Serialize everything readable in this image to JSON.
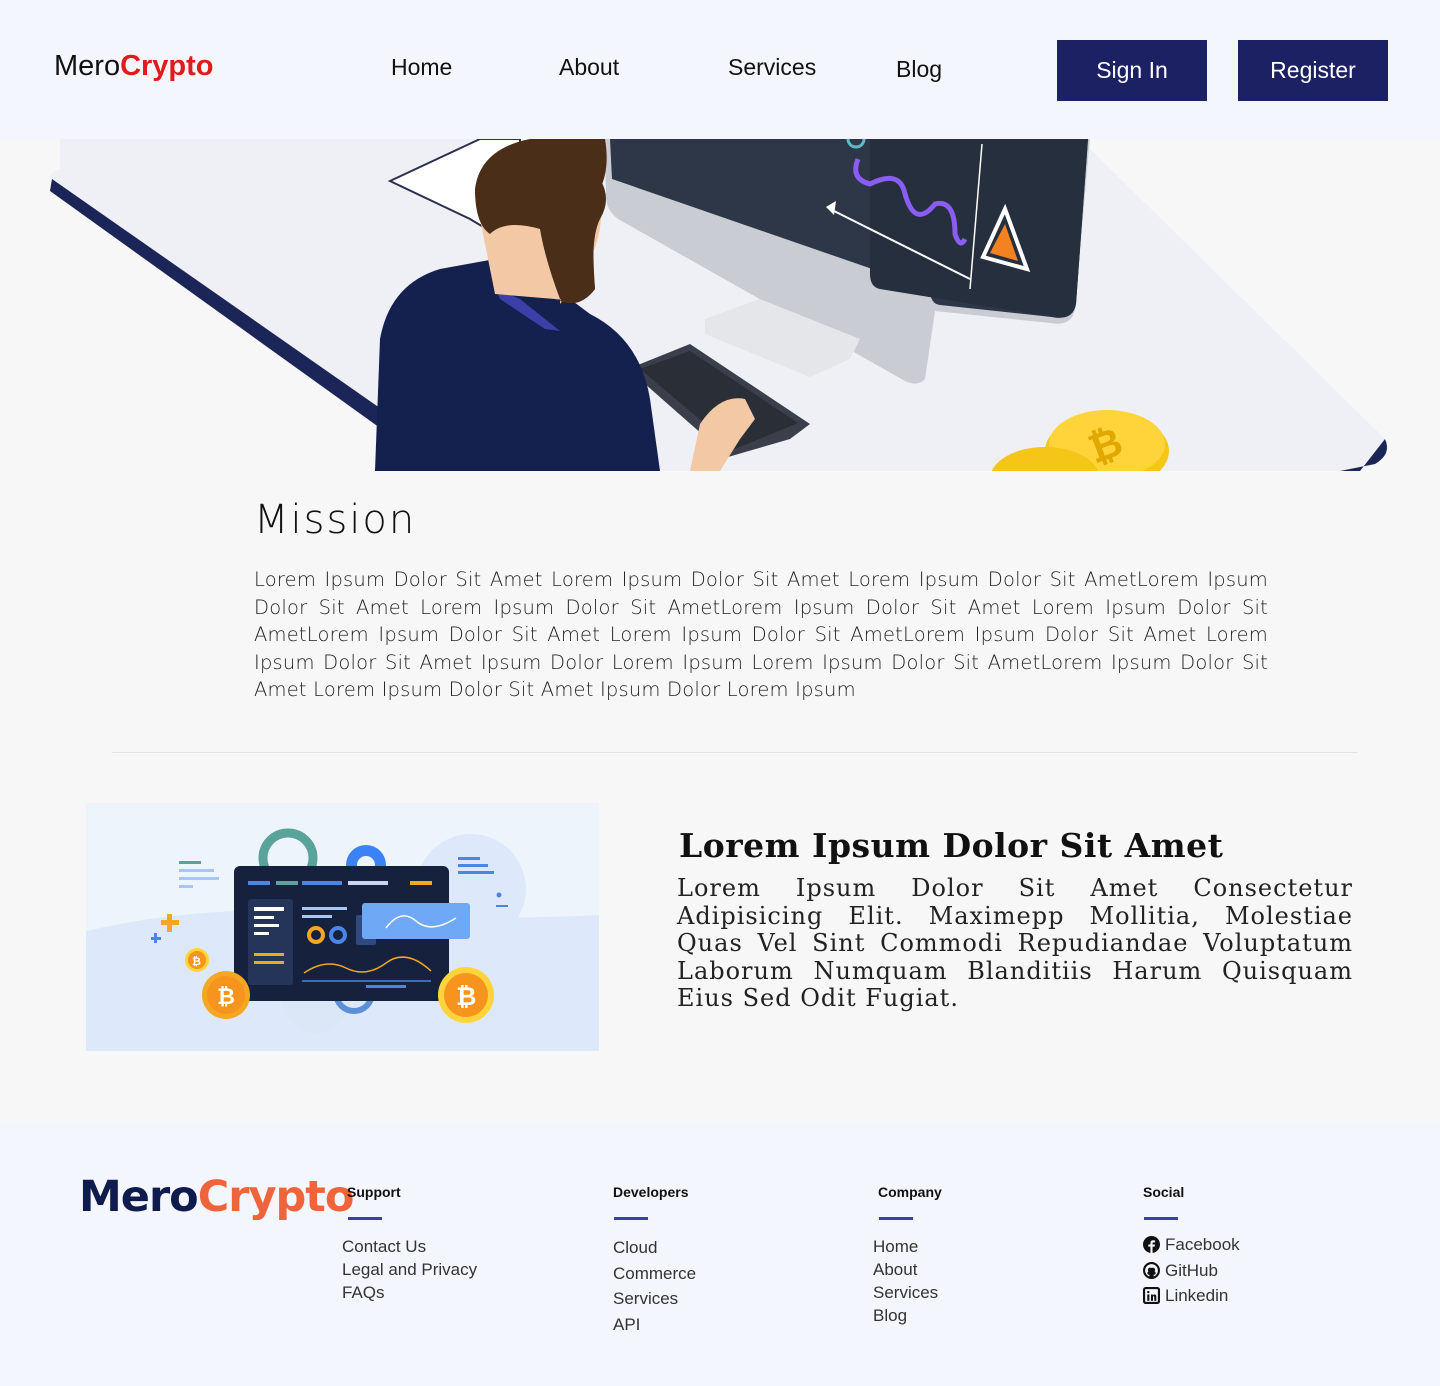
{
  "header": {
    "brand_part1": "Mero",
    "brand_part2": "Crypto",
    "nav": [
      "Home",
      "About",
      "Services",
      "Blog"
    ],
    "sign_in_label": "Sign In",
    "register_label": "Register"
  },
  "mission": {
    "title": "Mission",
    "text": "Lorem Ipsum Dolor Sit Amet Lorem Ipsum Dolor Sit Amet Lorem Ipsum Dolor Sit AmetLorem Ipsum Dolor Sit Amet Lorem Ipsum Dolor Sit AmetLorem Ipsum Dolor Sit Amet Lorem Ipsum Dolor Sit AmetLorem Ipsum Dolor Sit Amet Lorem Ipsum Dolor Sit AmetLorem Ipsum Dolor Sit Amet Lorem Ipsum Dolor Sit Amet Ipsum Dolor Lorem Ipsum  Lorem Ipsum Dolor Sit AmetLorem Ipsum Dolor Sit Amet Lorem Ipsum Dolor Sit Amet Ipsum Dolor Lorem Ipsum"
  },
  "feature": {
    "title": "Lorem Ipsum Dolor Sit Amet",
    "text": "Lorem Ipsum Dolor Sit Amet Consectetur Adipisicing Elit. Maximepp Mollitia, Molestiae Quas Vel Sint Commodi Repudiandae Voluptatum Laborum Numquam Blanditiis Harum Quisquam Eius Sed Odit Fugiat."
  },
  "footer": {
    "brand_part1": "Mero",
    "brand_part2": "Crypto",
    "support": {
      "title": "Support",
      "links": [
        "Contact Us",
        "Legal and Privacy",
        "FAQs"
      ]
    },
    "developers": {
      "title": "Developers",
      "links": [
        "Cloud",
        "Commerce",
        "Services",
        "API"
      ]
    },
    "company": {
      "title": "Company",
      "links": [
        "Home",
        "About",
        "Services",
        "Blog"
      ]
    },
    "social": {
      "title": "Social",
      "links": [
        "Facebook",
        "GitHub",
        "Linkedin"
      ]
    }
  },
  "colors": {
    "brand_red": "#e11b1b",
    "button_navy": "#1c2163",
    "footer_brand_navy": "#0f1a4d",
    "footer_brand_orange": "#f0643c",
    "accent_bar": "#3b3fa8"
  },
  "icons": [
    "facebook-icon",
    "github-icon",
    "linkedin-icon",
    "bitcoin-icon"
  ]
}
